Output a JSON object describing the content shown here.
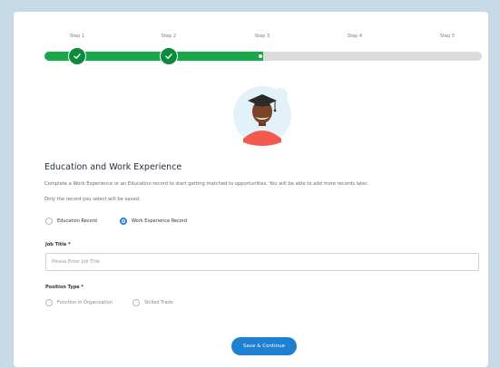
{
  "wizard": {
    "steps": [
      {
        "label": "Step 1",
        "status": "complete"
      },
      {
        "label": "Step 2",
        "status": "complete"
      },
      {
        "label": "Step 3",
        "status": "current"
      },
      {
        "label": "Step 4",
        "status": "upcoming"
      },
      {
        "label": "Step 5",
        "status": "upcoming"
      }
    ],
    "progress_fraction": 0.5,
    "accent_color": "#17a84a"
  },
  "avatar": {
    "icon": "graduate-avatar-icon"
  },
  "form": {
    "title": "Education and Work Experience",
    "description": "Complete a Work Experience or an Education record to start getting matched to opportunities. You will be able to add more records later.",
    "note": "Only the record you select will be saved.",
    "record_type": {
      "options": [
        "Education Record",
        "Work Experience Record"
      ],
      "selected": "Work Experience Record"
    },
    "job_title": {
      "label": "Job Title *",
      "value": "",
      "placeholder": "Please Enter Job Title"
    },
    "position_type": {
      "label": "Position Type *",
      "options": [
        "Function in Organization",
        "Skilled Trade"
      ],
      "selected": ""
    },
    "submit_label": "Save & Continue",
    "submit_color": "#1f7fd1"
  }
}
